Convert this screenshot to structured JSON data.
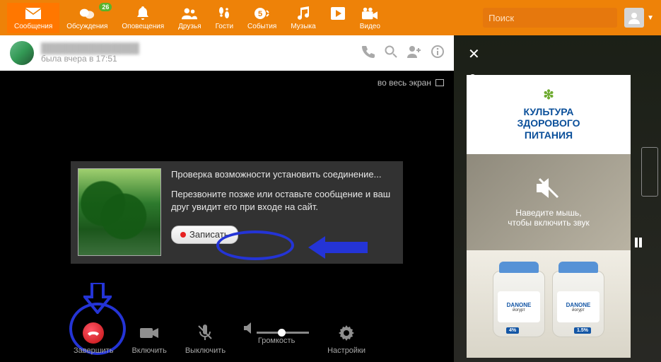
{
  "topbar": {
    "items": [
      {
        "label": "Сообщения"
      },
      {
        "label": "Обсуждения",
        "badge": "26"
      },
      {
        "label": "Оповещения"
      },
      {
        "label": "Друзья"
      },
      {
        "label": "Гости"
      },
      {
        "label": "События"
      },
      {
        "label": "Музыка"
      },
      {
        "label": "Видео"
      }
    ],
    "search_placeholder": "Поиск"
  },
  "chat": {
    "status": "была вчера в 17:51"
  },
  "call": {
    "fullscreen_label": "во весь экран",
    "msg_line1": "Проверка возможности установить соединение...",
    "msg_line2": "Перезвоните позже или оставьте сообщение и ваш друг увидит его при входе на сайт.",
    "record_label": "Записать",
    "controls": {
      "end": "Завершить",
      "cam_on": "Включить",
      "mic_off": "Выключить",
      "volume": "Громкость",
      "settings": "Настройки"
    }
  },
  "ads": {
    "ad1_line1": "КУЛЬТУРА",
    "ad1_line2": "ЗДОРОВОГО",
    "ad1_line3": "ПИТАНИЯ",
    "ad2_line1": "Наведите мышь,",
    "ad2_line2": "чтобы включить звук",
    "jar_brand": "DANONE",
    "jar_sub": "йогурт",
    "jar_tag_l": "4%",
    "jar_tag_r": "1.5%"
  }
}
